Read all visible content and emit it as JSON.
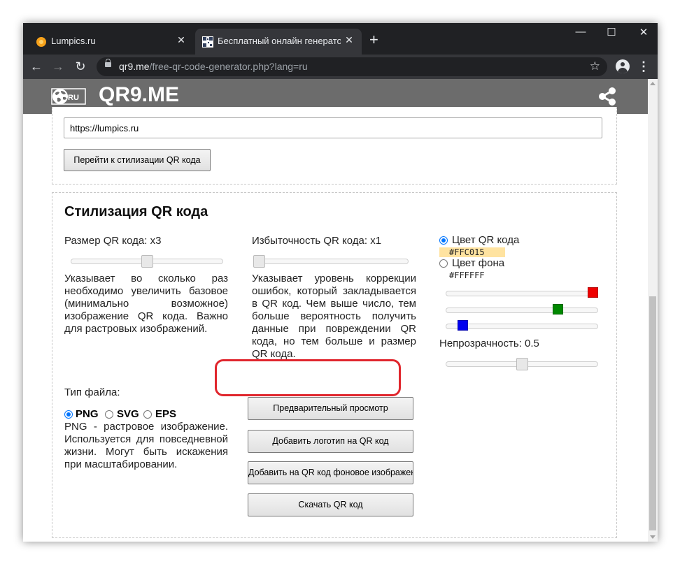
{
  "browser": {
    "tabs": [
      {
        "title": "Lumpics.ru",
        "active": false
      },
      {
        "title": "Бесплатный онлайн генератор QR",
        "active": true
      }
    ],
    "close_glyph": "✕",
    "new_tab_glyph": "+",
    "window_controls": {
      "minimize": "—",
      "maximize": "☐",
      "close": "✕"
    },
    "nav_glyphs": {
      "back": "←",
      "forward": "→",
      "reload": "↻"
    },
    "url_host": "qr9.me",
    "url_path": "/free-qr-code-generator.php?lang=ru",
    "bookmark_glyph": "☆",
    "menu_glyph": "⋮"
  },
  "site": {
    "title": "QR9.ME",
    "logo_label": "RU",
    "header_color": "#6c6c6c"
  },
  "link_panel": {
    "url_value": "https://lumpics.ru",
    "go_to_style_label": "Перейти к стилизации QR кода"
  },
  "style_panel": {
    "heading": "Стилизация QR кода",
    "size": {
      "label": "Размер QR кода: x3",
      "level": 0.5,
      "description": "Указывает во сколько раз необходимо увеличить базовое (минимально возможное) изображение QR кода. Важно для растровых изображений."
    },
    "redundancy": {
      "label": "Избыточность QR кода: x1",
      "level": 0.0,
      "description": "Указывает уровень коррекции ошибок, который закладывается в QR код. Чем выше число, тем больше вероятность получить данные при повреждении QR кода, но тем больше и размер QR кода."
    },
    "color": {
      "qr_color_label": "Цвет QR кода",
      "qr_color_value": "#FFC015",
      "qr_color_swatch": "#ffe3a0",
      "qr_color_selected": true,
      "bg_color_label": "Цвет фона",
      "bg_color_value": "#FFFFFF",
      "bg_color_selected": false,
      "rgb_sliders": [
        {
          "channel": "red",
          "value": 255,
          "color": "#ee0000"
        },
        {
          "channel": "green",
          "value": 192,
          "color": "#008800"
        },
        {
          "channel": "blue",
          "value": 21,
          "color": "#0000ee"
        }
      ],
      "opacity_label": "Непрозрачность: 0.5",
      "opacity_value": 0.5
    },
    "file_type": {
      "label": "Тип файла:",
      "options": [
        {
          "label": "PNG",
          "selected": true
        },
        {
          "label": "SVG",
          "selected": false
        },
        {
          "label": "EPS",
          "selected": false
        }
      ],
      "description": "PNG - растровое изображение. Используется для повседневной жизни. Могут быть искажения при масштабировании."
    },
    "buttons": {
      "preview": "Предварительный просмотр",
      "add_logo": "Добавить логотип на QR код",
      "add_background": "Добавить на QR код фоновое изображение",
      "download": "Скачать QR код"
    },
    "highlight_color": "#e0262d"
  }
}
